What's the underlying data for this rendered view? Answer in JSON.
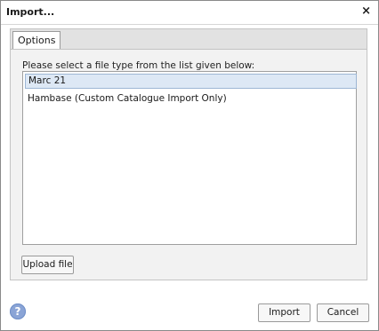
{
  "dialog": {
    "title": "Import...",
    "close_glyph": "×"
  },
  "tabs": [
    {
      "label": "Options",
      "active": true
    }
  ],
  "options": {
    "prompt": "Please select a file type from the list given below:",
    "file_types": [
      {
        "label": "Marc 21",
        "selected": true
      },
      {
        "label": "Hambase (Custom Catalogue Import Only)",
        "selected": false
      }
    ],
    "upload_label": "Upload file"
  },
  "footer": {
    "help_icon": "question-circle-icon",
    "import_label": "Import",
    "cancel_label": "Cancel"
  },
  "colors": {
    "selection_bg": "#dde8f5",
    "help_icon": "#8aa4d6"
  }
}
